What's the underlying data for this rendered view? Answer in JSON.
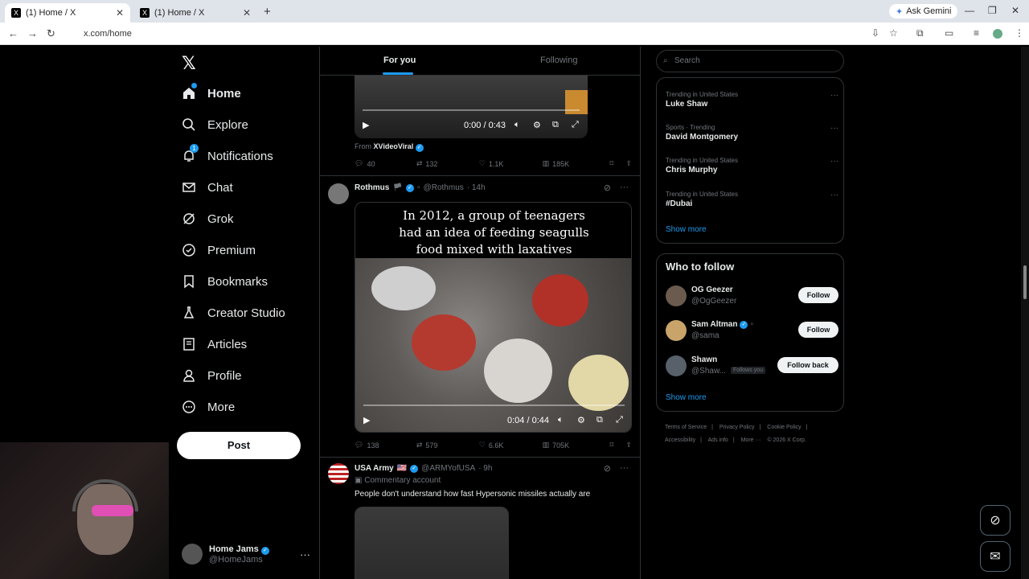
{
  "browser": {
    "tabs": [
      {
        "title": "(1) Home / X",
        "active": true
      },
      {
        "title": "(1) Home / X",
        "active": false
      }
    ],
    "new_tab": "+",
    "ask_gemini": "Ask Gemini",
    "url": "x.com/home"
  },
  "leftnav": {
    "logo": "𝕏",
    "items": [
      {
        "label": "Home",
        "icon": "home-icon"
      },
      {
        "label": "Explore",
        "icon": "search-icon"
      },
      {
        "label": "Notifications",
        "icon": "bell-icon",
        "badge": "1"
      },
      {
        "label": "Chat",
        "icon": "mail-icon"
      },
      {
        "label": "Grok",
        "icon": "grok-icon"
      },
      {
        "label": "Premium",
        "icon": "verified-icon"
      },
      {
        "label": "Bookmarks",
        "icon": "bookmark-icon"
      },
      {
        "label": "Creator Studio",
        "icon": "flask-icon"
      },
      {
        "label": "Articles",
        "icon": "article-icon"
      },
      {
        "label": "Profile",
        "icon": "person-icon"
      },
      {
        "label": "More",
        "icon": "more-icon"
      }
    ],
    "post_label": "Post",
    "account": {
      "name": "Home Jams",
      "handle": "@HomeJams"
    }
  },
  "feed": {
    "tabs": {
      "for_you": "For you",
      "following": "Following"
    },
    "tweet1": {
      "video_time": "0:00 / 0:43",
      "from_prefix": "From",
      "from_name": "XVideoViral",
      "replies": "40",
      "reposts": "132",
      "likes": "1.1K",
      "views": "185K"
    },
    "tweet2": {
      "name": "Rothmus",
      "handle": "@Rothmus",
      "time": "· 14h",
      "caption_lines": [
        "In 2012, a group of teenagers",
        "had an idea of feeding seagulls",
        "food mixed with laxatives"
      ],
      "video_time": "0:04 / 0:44",
      "replies": "138",
      "reposts": "579",
      "likes": "6.6K",
      "views": "705K"
    },
    "tweet3": {
      "name": "USA Army",
      "handle": "@ARMYofUSA",
      "time": "· 9h",
      "commentary": "Commentary account",
      "text": "People don't understand how fast Hypersonic missiles actually are"
    }
  },
  "right": {
    "search_placeholder": "Search",
    "trends": [
      {
        "context": "Trending in United States",
        "title": "Luke Shaw"
      },
      {
        "context": "Sports · Trending",
        "title": "David Montgomery"
      },
      {
        "context": "Trending in United States",
        "title": "Chris Murphy"
      },
      {
        "context": "Trending in United States",
        "title": "#Dubai"
      }
    ],
    "show_more": "Show more",
    "who_to_follow": "Who to follow",
    "follow_suggestions": [
      {
        "name": "OG Geezer",
        "handle": "@OgGeezer",
        "button": "Follow"
      },
      {
        "name": "Sam Altman",
        "handle": "@sama",
        "button": "Follow"
      },
      {
        "name": "Shawn",
        "handle": "@Shaw...",
        "follows_you": "Follows you",
        "button": "Follow back"
      }
    ],
    "show_more_2": "Show more",
    "footer": [
      "Terms of Service",
      "|",
      "Privacy Policy",
      "|",
      "Cookie Policy",
      "|",
      "Accessibility",
      "|",
      "Ads info",
      "|",
      "More ···",
      "© 2026 X Corp."
    ]
  },
  "colors": {
    "accent": "#1d9bf0",
    "background": "#000000",
    "border": "#2f3336"
  }
}
